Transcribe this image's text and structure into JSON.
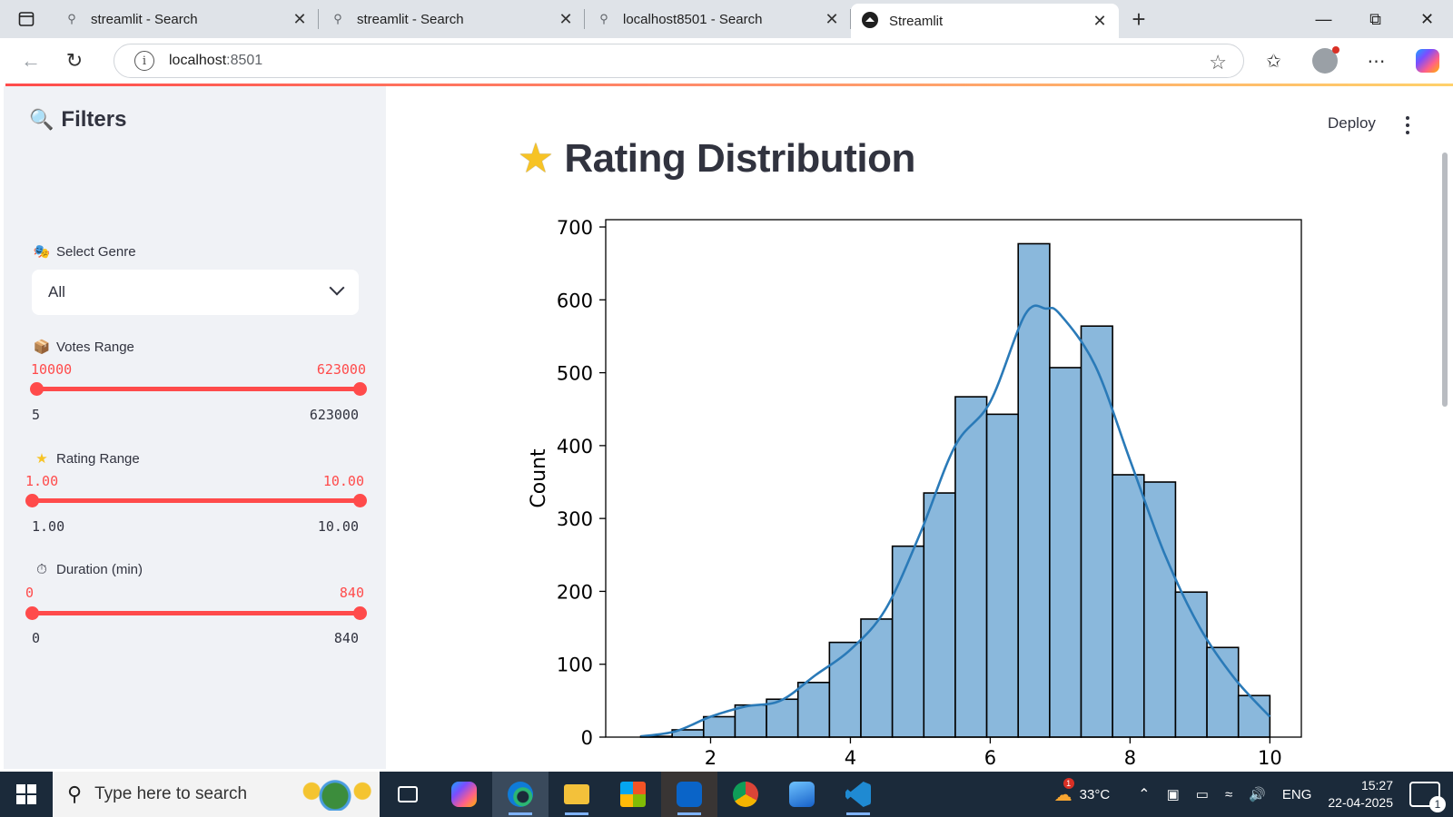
{
  "browser": {
    "tabs": [
      {
        "title": "streamlit - Search",
        "icon": "search-icon",
        "active": false
      },
      {
        "title": "streamlit - Search",
        "icon": "search-icon",
        "active": false
      },
      {
        "title": "localhost8501 - Search",
        "icon": "search-icon",
        "active": false
      },
      {
        "title": "Streamlit",
        "icon": "streamlit-logo-icon",
        "active": true
      }
    ],
    "url_host": "localhost",
    "url_port": ":8501"
  },
  "app": {
    "deploy_label": "Deploy",
    "title": "Rating Distribution",
    "title_icon": "star-emoji-icon"
  },
  "sidebar": {
    "heading": "Filters",
    "heading_icon": "magnifier-emoji-icon",
    "genre": {
      "label": "Select Genre",
      "icon": "theater-masks-emoji-icon",
      "value": "All"
    },
    "votes": {
      "label": "Votes Range",
      "icon": "package-emoji-icon",
      "low": "10000",
      "high": "623000",
      "min": "5",
      "max": "623000",
      "low_frac": 0.016,
      "high_frac": 1.0
    },
    "rating": {
      "label": "Rating Range",
      "icon": "star-emoji-icon",
      "low": "1.00",
      "high": "10.00",
      "min": "1.00",
      "max": "10.00",
      "low_frac": 0.0,
      "high_frac": 1.0
    },
    "duration": {
      "label": "Duration (min)",
      "icon": "stopwatch-emoji-icon",
      "low": "0",
      "high": "840",
      "min": "0",
      "max": "840",
      "low_frac": 0.0,
      "high_frac": 1.0
    }
  },
  "chart_data": {
    "type": "bar",
    "subtype": "histogram-with-kde",
    "ylabel": "Count",
    "xlabel": "",
    "xlim": [
      0.5,
      10.45
    ],
    "ylim": [
      0,
      710
    ],
    "xticks": [
      2,
      4,
      6,
      8,
      10
    ],
    "yticks": [
      0,
      100,
      200,
      300,
      400,
      500,
      600,
      700
    ],
    "bin_edges": [
      1.0,
      1.45,
      1.9,
      2.35,
      2.8,
      3.25,
      3.7,
      4.15,
      4.6,
      5.05,
      5.5,
      5.95,
      6.4,
      6.85,
      7.3,
      7.75,
      8.2,
      8.65,
      9.1,
      9.55,
      10.0
    ],
    "counts": [
      1,
      10,
      28,
      44,
      52,
      75,
      130,
      162,
      262,
      335,
      467,
      443,
      677,
      507,
      564,
      360,
      350,
      199,
      123,
      57
    ],
    "kde_x": [
      1.0,
      1.5,
      2.0,
      2.5,
      3.0,
      3.5,
      4.0,
      4.5,
      5.0,
      5.5,
      6.0,
      6.5,
      6.8,
      7.0,
      7.5,
      8.0,
      8.5,
      9.0,
      9.5,
      10.0
    ],
    "kde_y": [
      1,
      8,
      28,
      42,
      50,
      85,
      120,
      175,
      280,
      400,
      460,
      580,
      588,
      580,
      510,
      380,
      250,
      150,
      80,
      28
    ],
    "bar_color": "#8ab8dc",
    "kde_color": "#2a7ab8",
    "grid": false
  },
  "taskbar": {
    "search_placeholder": "Type here to search",
    "weather": "33°C",
    "weather_badge": "1",
    "language": "ENG",
    "time": "15:27",
    "date": "22-04-2025",
    "notification_count": "1",
    "apps": [
      "task-view-icon",
      "copilot-icon",
      "edge-icon",
      "file-explorer-icon",
      "store-icon",
      "outlook-icon",
      "chrome-icon",
      "photos-icon",
      "vscode-icon"
    ]
  },
  "colors": {
    "accent": "#ff4b4b",
    "sidebar_bg": "#f0f2f6",
    "text": "#31333f"
  }
}
